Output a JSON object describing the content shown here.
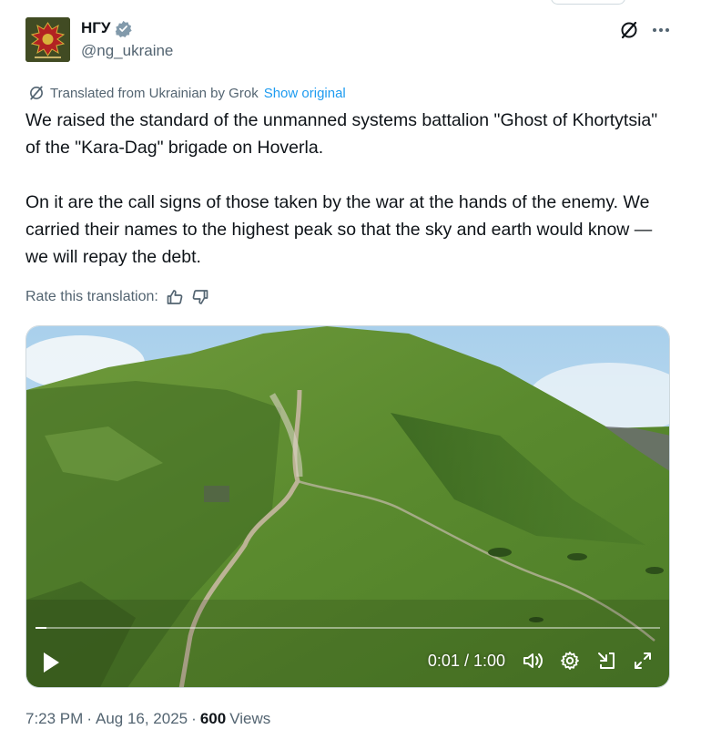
{
  "author": {
    "name": "НГУ",
    "handle": "@ng_ukraine",
    "verified_color": "#829aab"
  },
  "header_icons": [
    "grok-translate-icon",
    "more-icon"
  ],
  "translation": {
    "label": "Translated from Ukrainian by Grok",
    "show_original": "Show original"
  },
  "tweet": {
    "text": "We raised the standard of the unmanned systems battalion \"Ghost of Khortytsia\" of the \"Kara-Dag\" brigade on Hoverla.\n\nOn it are the call signs of those taken by the war at the hands of the enemy. We carried their names to the highest peak so that the sky and earth would know — we will repay the debt."
  },
  "rate": {
    "label": "Rate this translation:"
  },
  "video": {
    "current_time": "0:01",
    "duration": "1:00",
    "time_display": "0:01 / 1:00",
    "progress_fraction": 0.017
  },
  "meta": {
    "time": "7:23 PM",
    "separator": "·",
    "date": "Aug 16, 2025",
    "views_count": "600",
    "views_label": "Views"
  },
  "colors": {
    "accent": "#1d9bf0",
    "secondary_text": "#536471",
    "primary_text": "#0f1419"
  }
}
